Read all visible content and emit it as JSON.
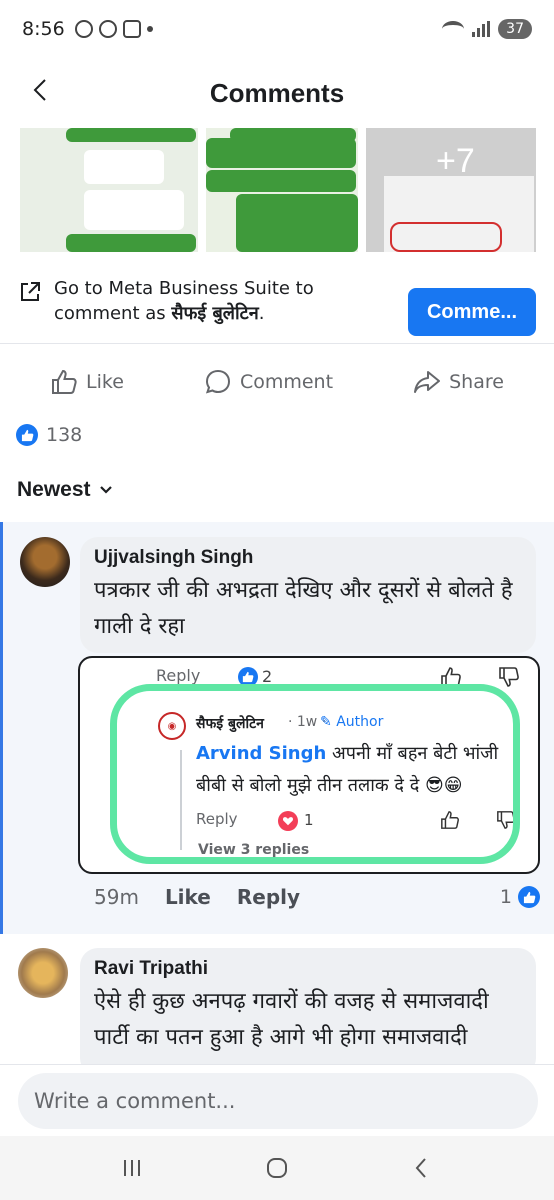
{
  "status_bar": {
    "time": "8:56",
    "battery": "37"
  },
  "header": {
    "title": "Comments"
  },
  "media": {
    "more_count": "+7"
  },
  "meta_business": {
    "text_prefix": "Go to Meta Business Suite to comment as ",
    "page_name": "सैफई बुलेटिन",
    "text_suffix": ".",
    "button_label": "Comme..."
  },
  "actions": {
    "like": "Like",
    "comment": "Comment",
    "share": "Share"
  },
  "reactions": {
    "count": "138"
  },
  "sort": {
    "label": "Newest"
  },
  "comments": [
    {
      "author": "Ujjvalsingh Singh",
      "text": "पत्रकार जी की अभद्रता देखिए और दूसरों से बोलते है गाली दे रहा",
      "time": "59m",
      "like_label": "Like",
      "reply_label": "Reply",
      "reaction_count": "1",
      "screenshot": {
        "reply_label": "Reply",
        "like_count": "2",
        "page_name": "सैफई बुलेटिन",
        "time": "· 1w ·",
        "author_badge": "Author",
        "mention": "Arvind Singh",
        "text": " अपनी माँ बहन बेटी भांजी बीबी से बोलो मुझे तीन तलाक दे दे 😎😁",
        "reply_label_2": "Reply",
        "heart_count": "1",
        "view_replies": "View 3 replies"
      }
    },
    {
      "author": "Ravi Tripathi",
      "text": "ऐसे ही कुछ अनपढ़ गवारों की वजह से समाजवादी पार्टी का पतन हुआ है आगे भी होगा समाजवादी"
    }
  ],
  "compose": {
    "placeholder": "Write a comment..."
  },
  "colors": {
    "accent": "#1877f2",
    "highlight_ring": "#5ee6a4",
    "thread_border": "#3578e5"
  }
}
